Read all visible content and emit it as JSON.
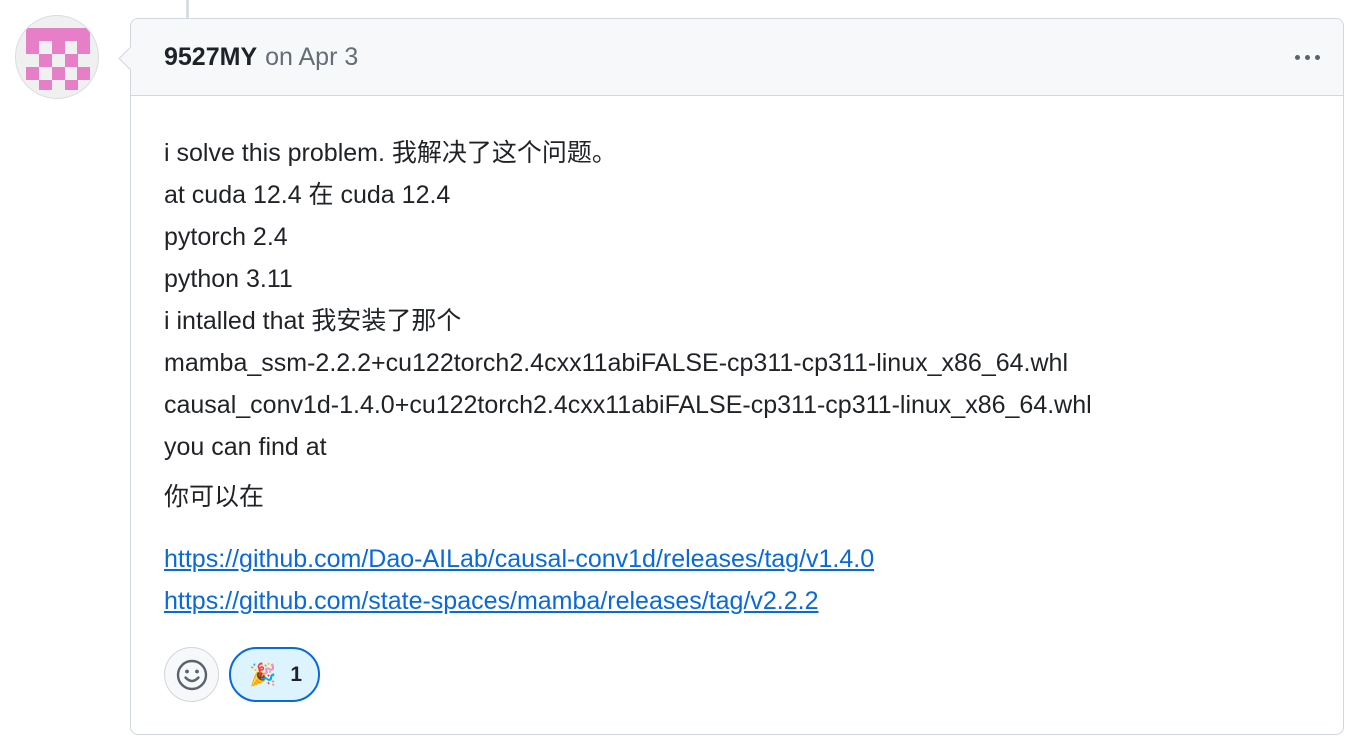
{
  "comment": {
    "author": "9527MY",
    "date": "on Apr 3",
    "lines": [
      "i solve this problem.  我解决了这个问题。",
      "at cuda 12.4  在 cuda 12.4",
      "pytorch 2.4",
      "python 3.11",
      "i intalled that  我安装了那个",
      "mamba_ssm-2.2.2+cu122torch2.4cxx11abiFALSE-cp311-cp311-linux_x86_64.whl",
      "causal_conv1d-1.4.0+cu122torch2.4cxx11abiFALSE-cp311-cp311-linux_x86_64.whl",
      "you can find at"
    ],
    "chinese_line": "你可以在",
    "links": [
      "https://github.com/Dao-AILab/causal-conv1d/releases/tag/v1.4.0",
      "https://github.com/state-spaces/mamba/releases/tag/v2.2.2"
    ]
  },
  "reactions": {
    "add_icon": "smiley-icon",
    "items": [
      {
        "emoji": "🎉",
        "icon": "tada-icon",
        "count": "1"
      }
    ]
  },
  "menu_icon": "kebab-horizontal-icon",
  "colors": {
    "link": "#0969da",
    "border": "#d0d7de",
    "header_bg": "#f6f8fa",
    "reaction_active_bg": "#ddf4ff",
    "avatar_pink": "#e67ec8"
  }
}
